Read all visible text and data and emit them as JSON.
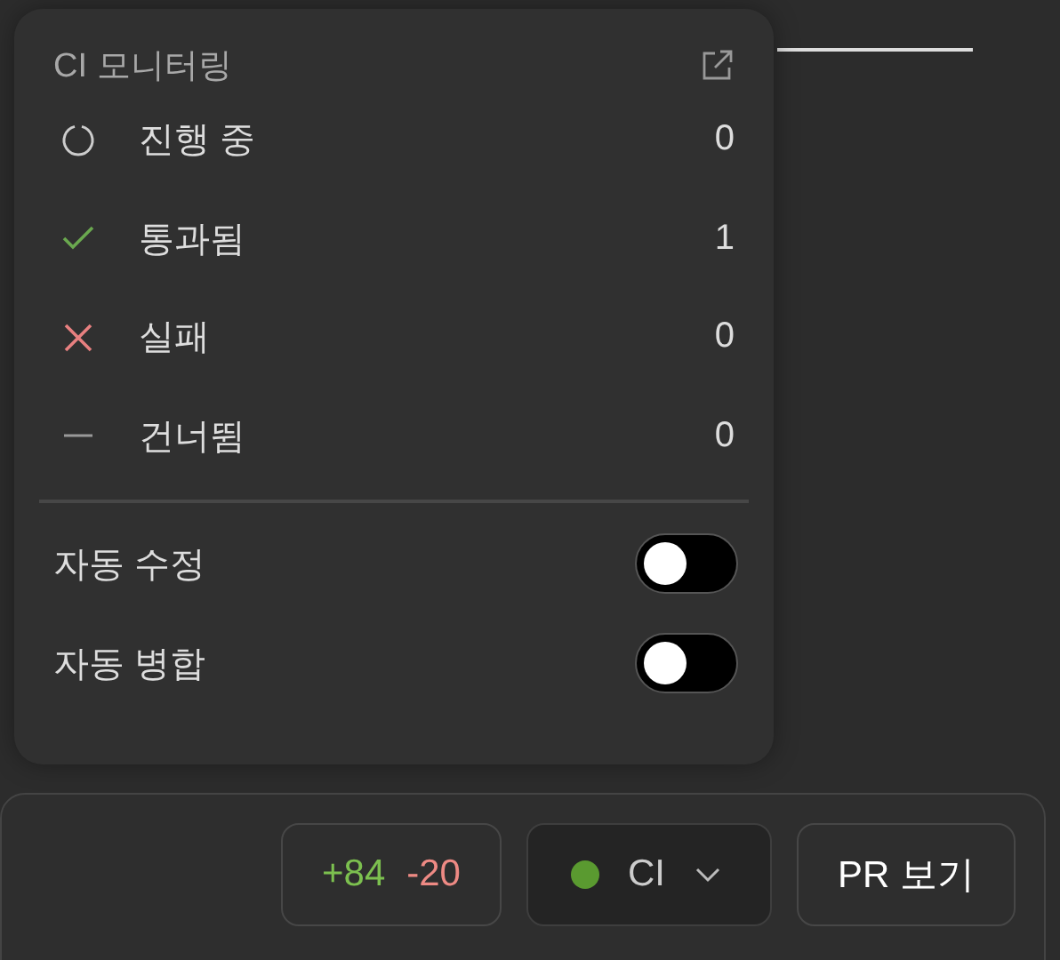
{
  "popover": {
    "title": "CI 모니터링",
    "statuses": [
      {
        "kind": "running",
        "label": "진행 중",
        "count": "0"
      },
      {
        "kind": "passed",
        "label": "통과됨",
        "count": "1"
      },
      {
        "kind": "failed",
        "label": "실패",
        "count": "0"
      },
      {
        "kind": "skipped",
        "label": "건너뜀",
        "count": "0"
      }
    ],
    "toggles": [
      {
        "label": "자동 수정",
        "on": false
      },
      {
        "label": "자동 병합",
        "on": false
      }
    ]
  },
  "footer": {
    "additions": "+84",
    "deletions": "-20",
    "ci_button": {
      "label": "CI",
      "color": "#5a9a30"
    },
    "pr_button": "PR 보기"
  }
}
